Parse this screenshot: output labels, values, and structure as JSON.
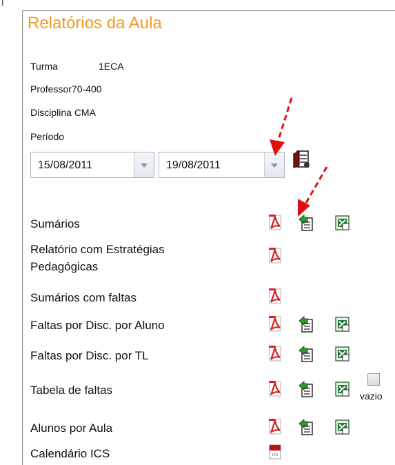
{
  "page": {
    "title": "Relatórios da Aula"
  },
  "info": {
    "turma_label": "Turma",
    "turma_value": "1ECA",
    "professor_label": "Professor",
    "professor_value": "70-400",
    "disciplina_label": "Disciplina",
    "disciplina_value": "CMA",
    "periodo_label": "Período"
  },
  "period": {
    "start": "15/08/2011",
    "end": "19/08/2011"
  },
  "reports": [
    {
      "label": "Sumários",
      "formats": [
        "pdf",
        "export",
        "excel"
      ]
    },
    {
      "label": "Relatório com Estratégias",
      "label2": "Pedagógicas",
      "formats": [
        "pdf"
      ]
    },
    {
      "label": "Sumários com faltas",
      "formats": [
        "pdf"
      ]
    },
    {
      "label": "Faltas por Disc. por Aluno",
      "formats": [
        "pdf",
        "export",
        "excel"
      ]
    },
    {
      "label": "Faltas por Disc. por TL",
      "formats": [
        "pdf",
        "export",
        "excel"
      ]
    },
    {
      "label": "Tabela de faltas",
      "formats": [
        "pdf",
        "export",
        "excel"
      ],
      "checkbox_label": "vazio"
    },
    {
      "label": "Alunos por Aula",
      "formats": [
        "pdf",
        "export",
        "excel"
      ]
    },
    {
      "label": "Calendário ICS",
      "formats": [
        "ics"
      ]
    }
  ],
  "colors": {
    "title": "#f39a1f",
    "pdf_red": "#d42020",
    "export_green": "#2f9a2f",
    "excel_green": "#1e7a3a",
    "annotation_arrow": "#e01010"
  },
  "icons": {
    "pdf": "pdf-icon",
    "export": "export-icon",
    "excel": "excel-icon",
    "ics": "calendar-file-icon",
    "notebook": "notebook-icon"
  }
}
